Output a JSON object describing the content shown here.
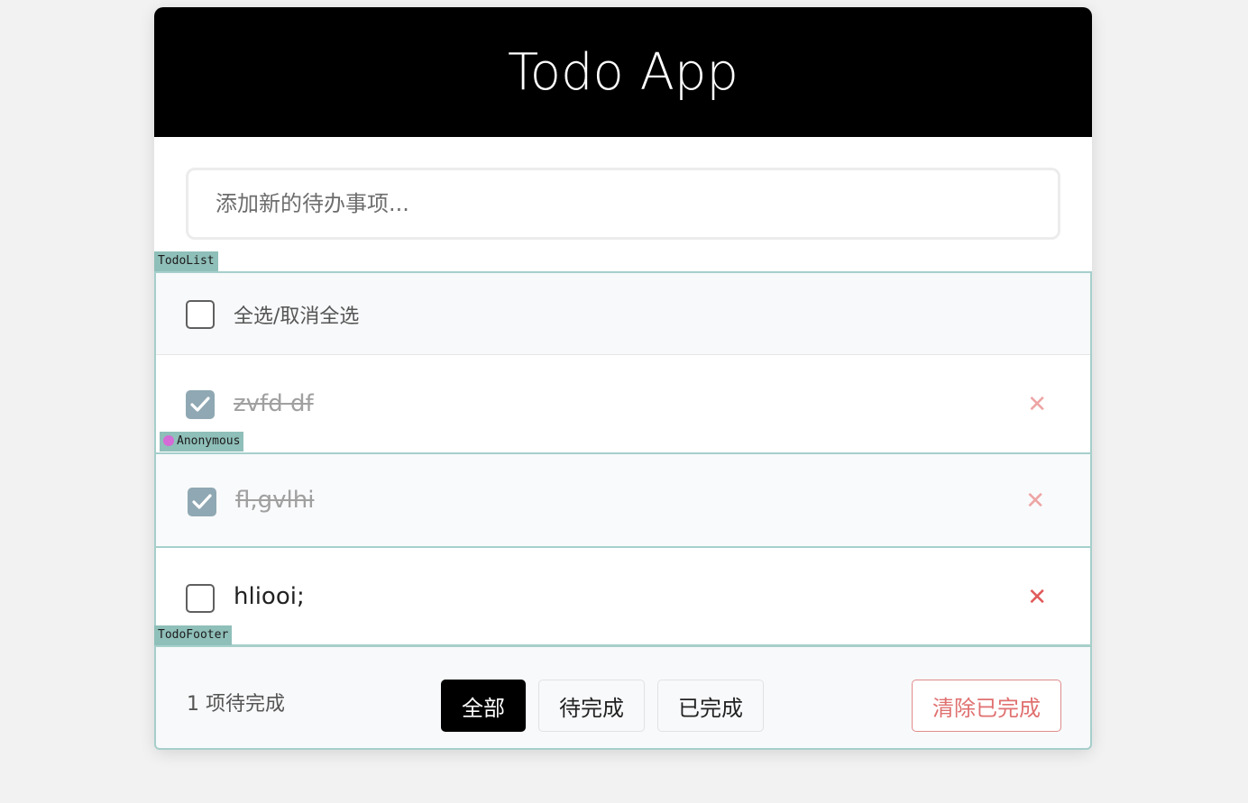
{
  "header": {
    "title": "Todo App"
  },
  "new_todo": {
    "placeholder": "添加新的待办事项..."
  },
  "dev_labels": {
    "todolist": "TodoList",
    "anonymous": "Anonymous",
    "footer": "TodoFooter"
  },
  "toggle_all": {
    "label": "全选/取消全选",
    "checked": false
  },
  "todos": [
    {
      "text": "zvfd df",
      "completed": true
    },
    {
      "text": "fl,gvlhi",
      "completed": true
    },
    {
      "text": "hliooi;",
      "completed": false
    }
  ],
  "destroy_icon": "close-icon",
  "footer": {
    "count_text": "1 项待完成",
    "filters": [
      {
        "label": "全部",
        "active": true
      },
      {
        "label": "待完成",
        "active": false
      },
      {
        "label": "已完成",
        "active": false
      }
    ],
    "clear_label": "清除已完成"
  },
  "colors": {
    "header_bg": "#000000",
    "devtools_outline": "#a6cfcb",
    "destroy": "#e05a5a",
    "checked": "#8fa8b3"
  }
}
